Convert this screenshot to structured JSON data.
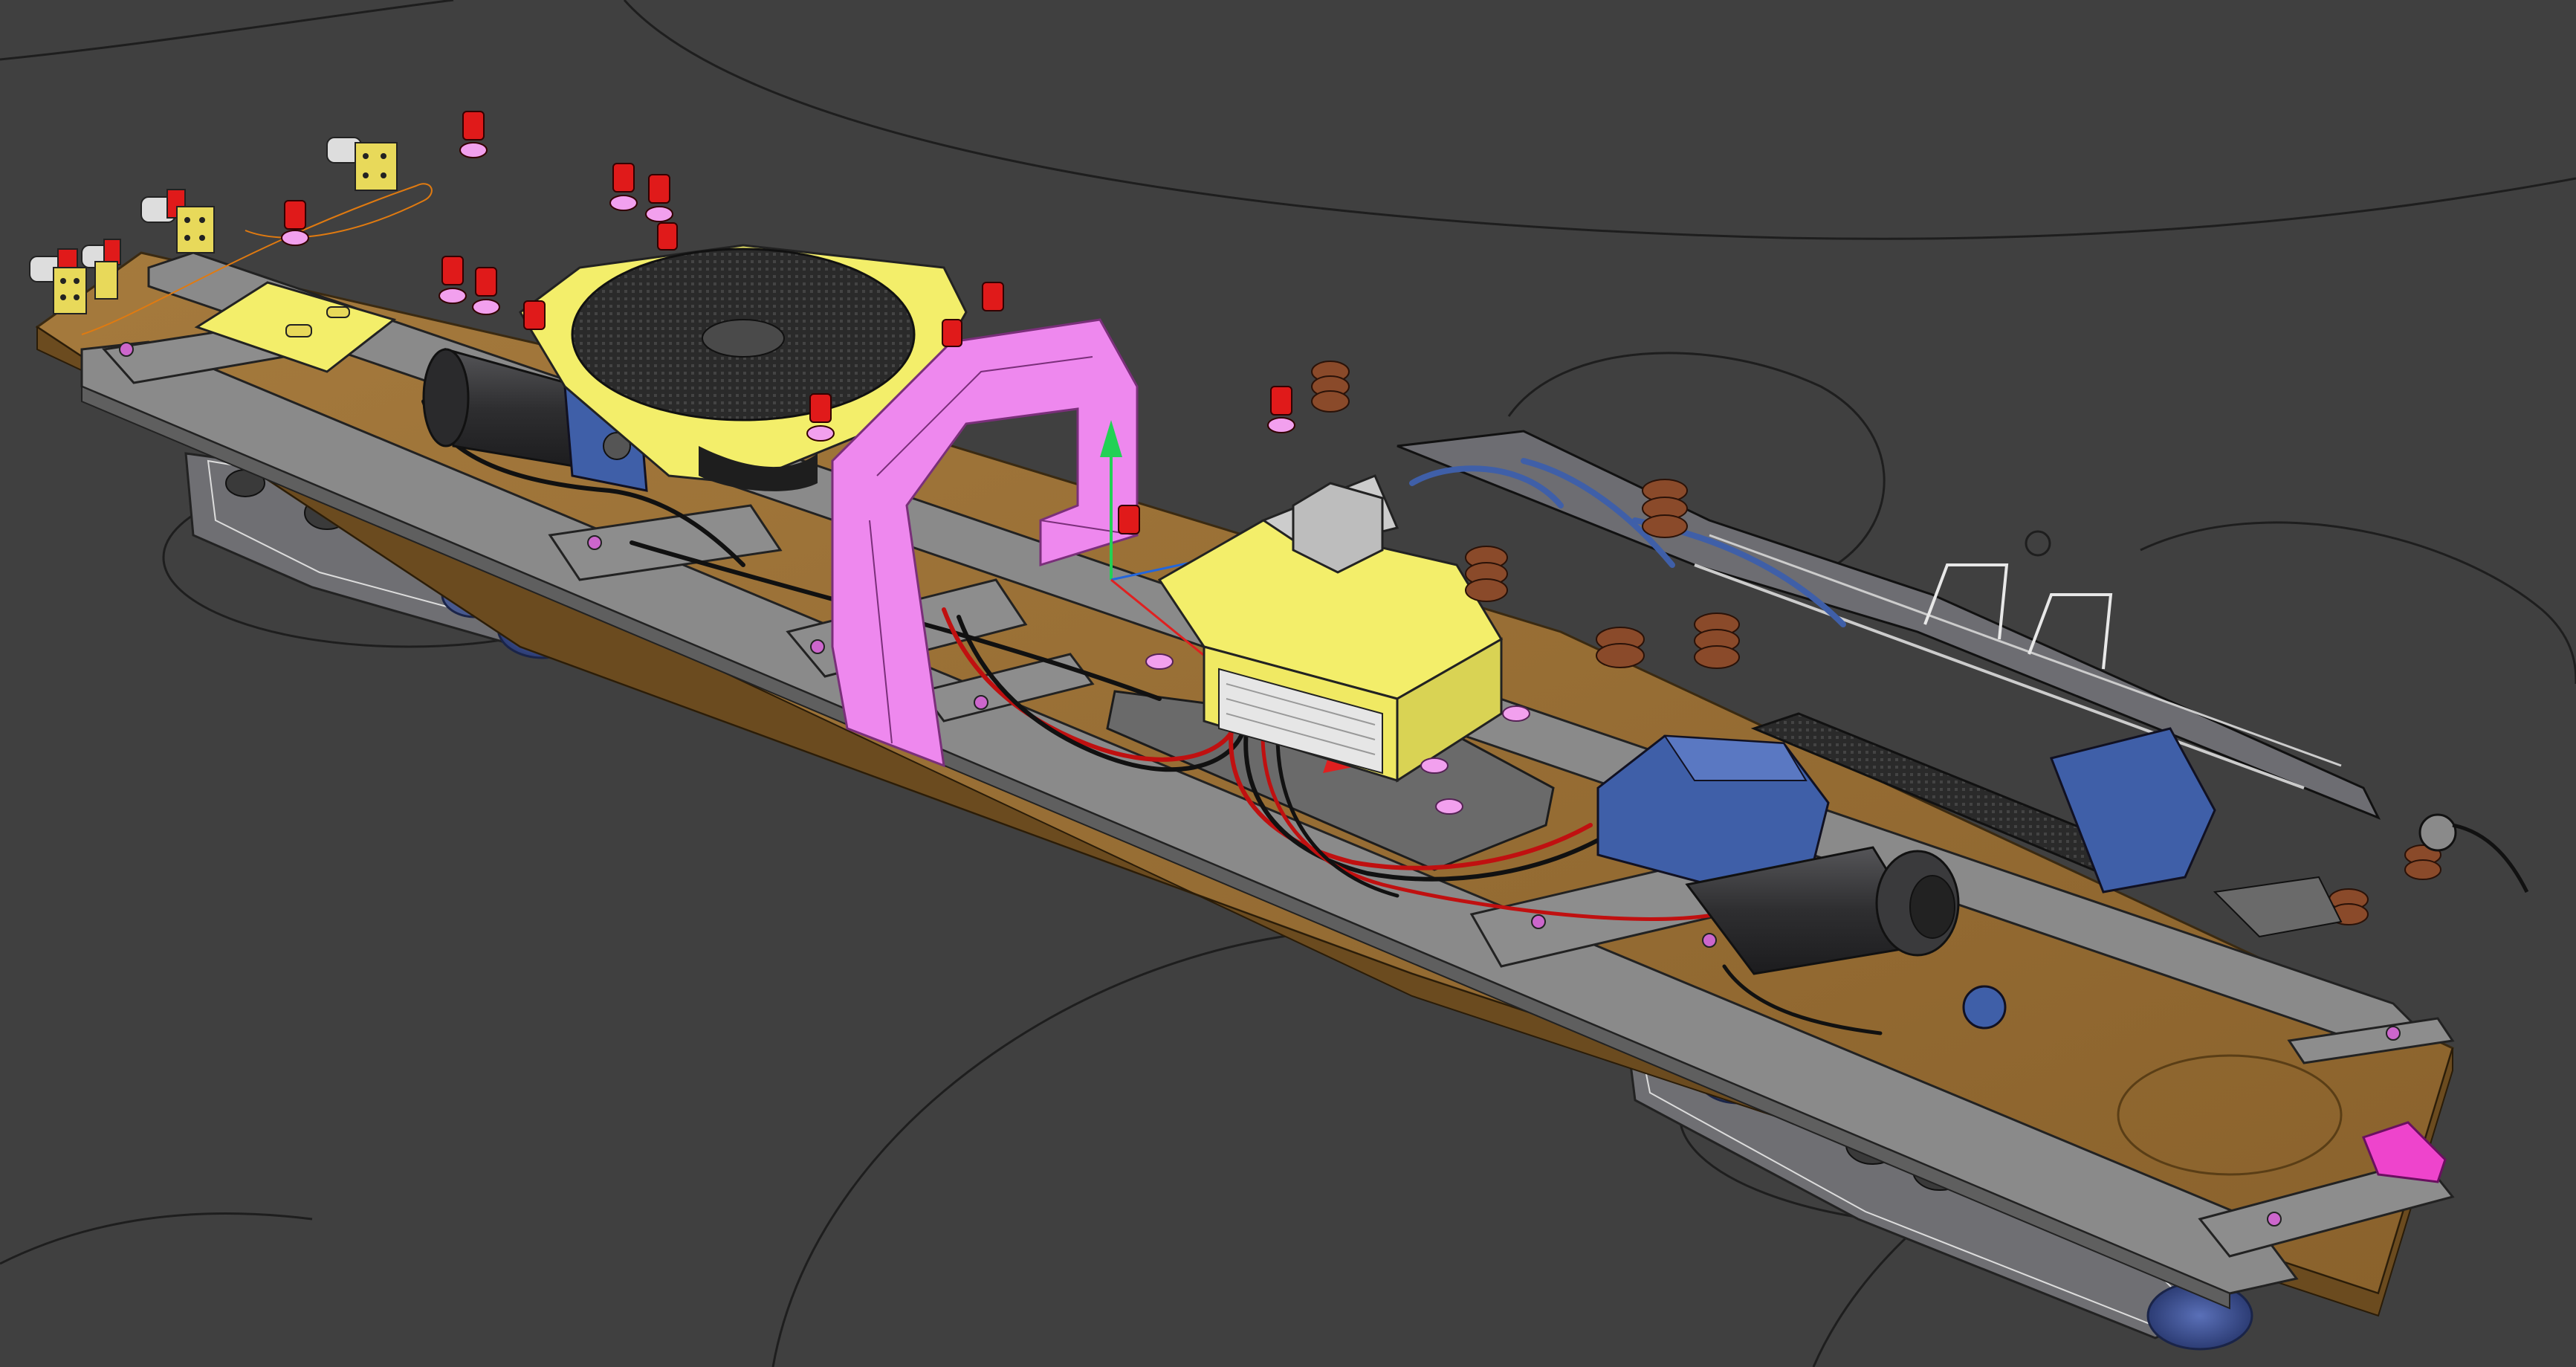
{
  "viewport": {
    "background": "#404040",
    "has_visible_text": false
  },
  "palette": {
    "background": "#404040",
    "frame_gray": "#8a8a8a",
    "deck_brown": "#9a6f35",
    "highlight_yellow": "#f3ee6a",
    "highlight_pink": "#ee88ee",
    "component_blue": "#3f5fa8",
    "motor_dark": "#2e2e30",
    "wire_red": "#c01010",
    "wire_black": "#111111",
    "coil_brown": "#8a4a2a",
    "gizmo_green": "#22d155",
    "gizmo_red": "#e02020",
    "gizmo_blue": "#2266dd",
    "wheel_blue": "#3a4f93"
  },
  "scene": {
    "model": "locomotive-underframe",
    "selected_parts_highlight": [
      "yellow",
      "pink"
    ],
    "gizmo": "transform-axes"
  }
}
